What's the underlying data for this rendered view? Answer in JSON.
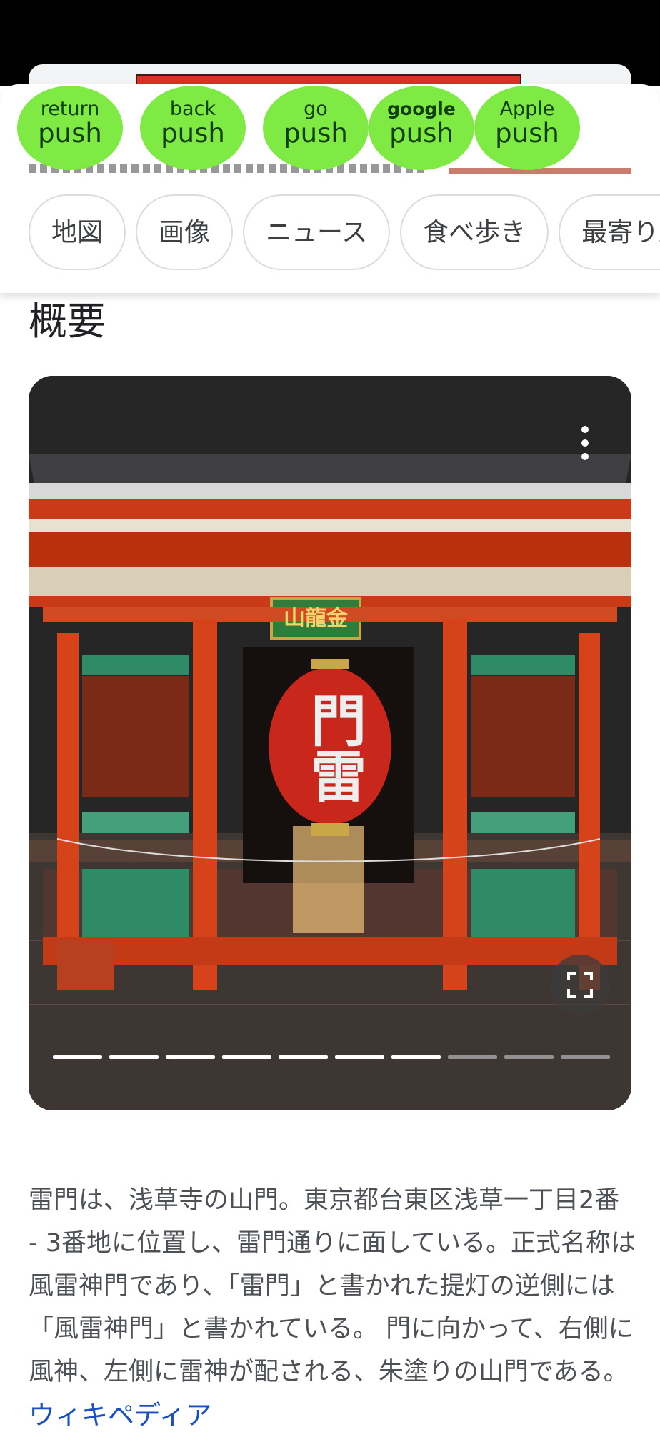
{
  "push_buttons": [
    {
      "top": "return",
      "bottom": "push"
    },
    {
      "top": "back",
      "bottom": "push"
    },
    {
      "top": "go",
      "bottom": "push"
    },
    {
      "top": "google",
      "bottom": "push"
    },
    {
      "top": "Apple",
      "bottom": "push"
    }
  ],
  "chips": [
    "地図",
    "画像",
    "ニュース",
    "食べ歩き",
    "最寄り駅"
  ],
  "section_title": "概要",
  "photo": {
    "plaque_text": "山龍金",
    "lantern_text": "門雷",
    "carousel_total": 10,
    "carousel_seen": 7
  },
  "description": "雷門は、浅草寺の山門。東京都台東区浅草一丁目2番 - 3番地に位置し、雷門通りに面している。正式名称は風雷神門であり、「雷門」と書かれた提灯の逆側には「風雷神門」と書かれている。 門に向かって、右側に風神、左側に雷神が配される、朱塗りの山門である。",
  "source_link": "ウィキペディア",
  "colors": {
    "push_green": "#7eea43",
    "link_blue": "#1a4fc4"
  }
}
